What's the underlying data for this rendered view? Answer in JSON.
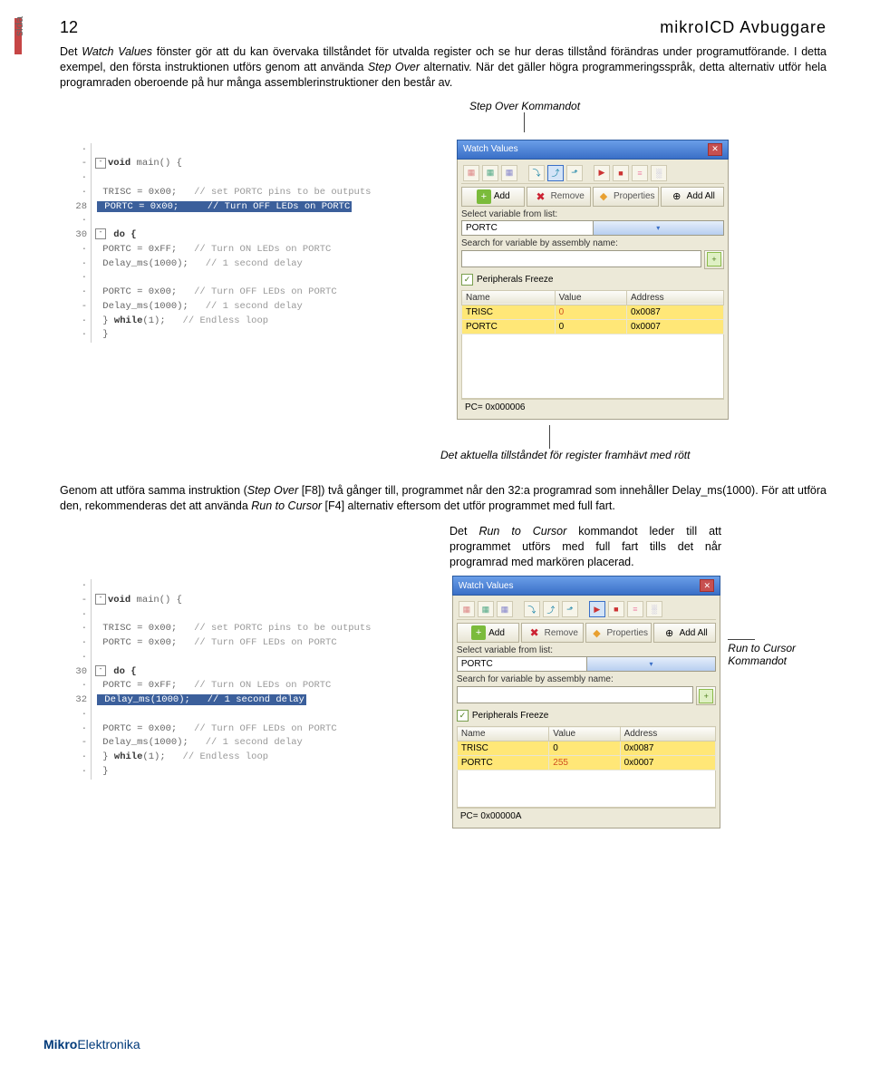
{
  "header": {
    "page_number": "12",
    "title": "mikroICD Avbuggare",
    "sida": "sida"
  },
  "paragraphs": {
    "p1_a": "Det ",
    "p1_b": "Watch Values",
    "p1_c": " fönster gör att du kan övervaka tillståndet för utvalda register och se hur deras tillstånd förändras under programutförande. I detta exempel, den första instruktionen utförs genom att använda ",
    "p1_d": "Step Over",
    "p1_e": " alternativ. När det gäller högra programmeringsspråk, detta alternativ utför hela programraden oberoende på hur många assemblerinstruktioner den består av.",
    "p2_a": "Genom att utföra samma instruktion (",
    "p2_b": "Step Over",
    "p2_c": " [F8]) två gånger till, programmet når den 32:a programrad som innehåller Delay_ms(1000). För att utföra den, rekommenderas det att använda ",
    "p2_d": "Run to Cursor",
    "p2_e": " [F4] alternativ eftersom det utför programmet med full fart.",
    "p3_a": "Det ",
    "p3_b": "Run to Cursor",
    "p3_c": " kommandot leder till att programmet utförs med full fart tills det når programrad med markören placerad."
  },
  "callouts": {
    "step_over": "Step Over Kommandot",
    "reg_highlight": "Det aktuella tillståndet för register framhävt med rött",
    "run_cursor": "Run to Cursor Kommandot"
  },
  "code1": {
    "lines": {
      "l1": {
        "g": "·",
        "txt": ""
      },
      "l2": {
        "g": "-",
        "kw": "void",
        "txt": " main() {"
      },
      "l3": {
        "g": "·",
        "txt": ""
      },
      "l4": {
        "g": "·",
        "txt": "   TRISC = 0x00;",
        "cm": "// set PORTC pins to be outputs"
      },
      "l5": {
        "g": "28",
        "txt": "   PORTC = 0x00;",
        "cm": "// Turn OFF LEDs on PORTC",
        "hl": true
      },
      "l6": {
        "g": "·",
        "txt": ""
      },
      "l7": {
        "g": "30",
        "txt": "   do {"
      },
      "l8": {
        "g": "·",
        "txt": "     PORTC = 0xFF;",
        "cm": "// Turn ON LEDs on PORTC"
      },
      "l9": {
        "g": "·",
        "txt": "     Delay_ms(1000);",
        "cm": "// 1 second delay"
      },
      "l10": {
        "g": "·",
        "txt": ""
      },
      "l11": {
        "g": "·",
        "txt": "     PORTC = 0x00;",
        "cm": "// Turn OFF LEDs on PORTC"
      },
      "l12": {
        "g": "-",
        "txt": "     Delay_ms(1000);",
        "cm": "// 1 second delay"
      },
      "l13": {
        "g": "·",
        "txt": "   } ",
        "kw": "while",
        "txt2": "(1);",
        "cm": "// Endless loop"
      },
      "l14": {
        "g": "·",
        "txt": " }"
      }
    }
  },
  "code2": {
    "lines": {
      "l1": {
        "g": "·",
        "txt": ""
      },
      "l2": {
        "g": "-",
        "kw": "void",
        "txt": " main() {"
      },
      "l3": {
        "g": "·",
        "txt": ""
      },
      "l4": {
        "g": "·",
        "txt": "   TRISC = 0x00;",
        "cm": "// set PORTC pins to be outputs"
      },
      "l5": {
        "g": "·",
        "txt": "   PORTC = 0x00;",
        "cm": "// Turn OFF LEDs on PORTC"
      },
      "l6": {
        "g": "·",
        "txt": ""
      },
      "l7": {
        "g": "30",
        "txt": "   do {"
      },
      "l8": {
        "g": "·",
        "txt": "     PORTC = 0xFF;",
        "cm": "// Turn ON LEDs on PORTC"
      },
      "l9": {
        "g": "32",
        "txt": "     Delay_ms(1000);",
        "cm": "// 1 second delay",
        "hl": true
      },
      "l10": {
        "g": "·",
        "txt": ""
      },
      "l11": {
        "g": "·",
        "txt": "     PORTC = 0x00;",
        "cm": "// Turn OFF LEDs on PORTC"
      },
      "l12": {
        "g": "-",
        "txt": "     Delay_ms(1000);",
        "cm": "// 1 second delay"
      },
      "l13": {
        "g": "·",
        "txt": "   } ",
        "kw": "while",
        "txt2": "(1);",
        "cm": "// Endless loop"
      },
      "l14": {
        "g": "·",
        "txt": " }"
      }
    }
  },
  "watch": {
    "title": "Watch Values",
    "btn_add": "Add",
    "btn_remove": "Remove",
    "btn_props": "Properties",
    "btn_addall": "Add All",
    "lbl_select": "Select variable from list:",
    "dd_value": "PORTC",
    "lbl_search": "Search for variable by assembly name:",
    "chk_freeze": "Peripherals Freeze",
    "th_name": "Name",
    "th_value": "Value",
    "th_addr": "Address"
  },
  "watch1": {
    "rows": [
      {
        "n": "TRISC",
        "v": "0",
        "a": "0x0087"
      },
      {
        "n": "PORTC",
        "v": "0",
        "a": "0x0007"
      }
    ],
    "pc": "PC= 0x000006"
  },
  "watch2": {
    "rows": [
      {
        "n": "TRISC",
        "v": "0",
        "a": "0x0087"
      },
      {
        "n": "PORTC",
        "v": "255",
        "a": "0x0007"
      }
    ],
    "pc": "PC= 0x00000A"
  },
  "footer": {
    "brand_a": "Mikro",
    "brand_b": "Elektronika"
  }
}
